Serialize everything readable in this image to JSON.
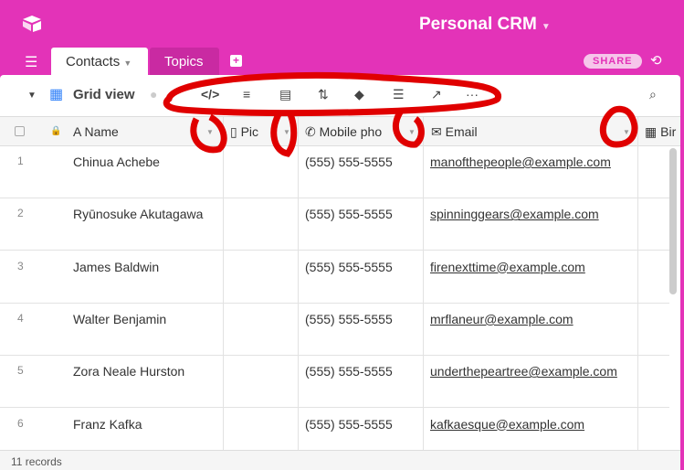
{
  "header": {
    "title": "Personal CRM"
  },
  "tabs": [
    {
      "label": "Contacts"
    },
    {
      "label": "Topics"
    }
  ],
  "share_label": "SHARE",
  "view": {
    "name": "Grid view"
  },
  "columns": [
    "Name",
    "Pic",
    "Mobile pho",
    "Email",
    "Bir"
  ],
  "rows": [
    {
      "n": "1",
      "name": "Chinua Achebe",
      "phone": "(555) 555-5555",
      "email": "manofthepeople@example.com"
    },
    {
      "n": "2",
      "name": "Ryūnosuke Akutagawa",
      "phone": "(555) 555-5555",
      "email": "spinninggears@example.com"
    },
    {
      "n": "3",
      "name": "James Baldwin",
      "phone": "(555) 555-5555",
      "email": "firenexttime@example.com"
    },
    {
      "n": "4",
      "name": "Walter Benjamin",
      "phone": "(555) 555-5555",
      "email": "mrflaneur@example.com"
    },
    {
      "n": "5",
      "name": "Zora Neale Hurston",
      "phone": "(555) 555-5555",
      "email": "underthepeartree@example.com"
    },
    {
      "n": "6",
      "name": "Franz Kafka",
      "phone": "(555) 555-5555",
      "email": "kafkaesque@example.com"
    }
  ],
  "footer": {
    "count": "11 records"
  },
  "colors": {
    "brand": "#e333b8",
    "annotation": "#e00000"
  }
}
